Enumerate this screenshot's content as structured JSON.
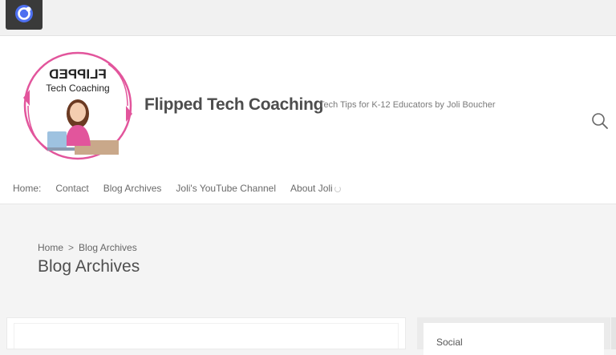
{
  "browser": {
    "extension_icon": "c-circle-icon"
  },
  "header": {
    "logo_text_top": "FLIPPED",
    "logo_text_bottom": "Tech Coaching",
    "site_title": "Flipped Tech Coaching",
    "tagline": "Tech Tips for K-12 Educators by Joli Boucher",
    "search_icon": "search-icon"
  },
  "nav": {
    "items": [
      "Home:",
      "Contact",
      "Blog Archives",
      "Joli's YouTube Channel",
      "About Joli"
    ]
  },
  "page": {
    "breadcrumb": [
      "Home",
      "Blog Archives"
    ],
    "breadcrumb_sep": ">",
    "title": "Blog Archives"
  },
  "sidebar": {
    "widget_title": "Social"
  },
  "colors": {
    "accent": "#e2559c",
    "text": "#4d4d4d"
  }
}
